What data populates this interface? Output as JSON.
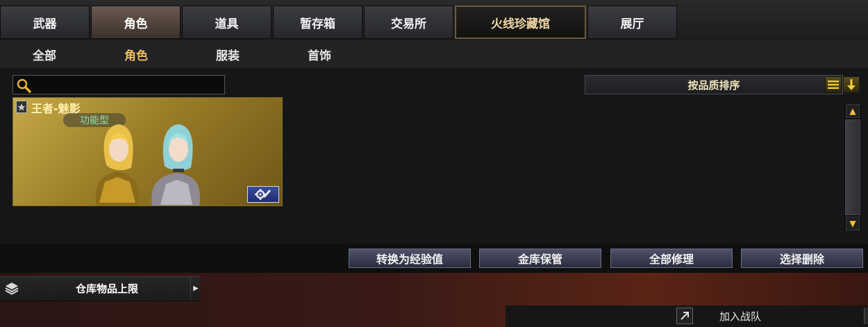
{
  "top_tabs": [
    {
      "label": "武器",
      "selected": false
    },
    {
      "label": "角色",
      "selected": true
    },
    {
      "label": "道具",
      "selected": false
    },
    {
      "label": "暂存箱",
      "selected": false
    },
    {
      "label": "交易所",
      "selected": false
    },
    {
      "label": "火线珍藏馆",
      "selected": false,
      "special": true
    },
    {
      "label": "展厅",
      "selected": false
    }
  ],
  "sub_tabs": [
    {
      "label": "全部",
      "selected": false
    },
    {
      "label": "角色",
      "selected": true
    },
    {
      "label": "服装",
      "selected": false
    },
    {
      "label": "首饰",
      "selected": false
    }
  ],
  "search": {
    "placeholder": "",
    "value": ""
  },
  "sort": {
    "label": "按品质排序",
    "icons": [
      "list-icon",
      "arrow-down-icon"
    ]
  },
  "items": [
    {
      "name": "王者-魅影",
      "type": "功能型",
      "rank_icon": "rank-badge-icon",
      "action_icon": "gear-wrench-icon",
      "card_color": "#b8962f"
    }
  ],
  "actions": [
    {
      "label": "转换为经验值"
    },
    {
      "label": "金库保管"
    },
    {
      "label": "全部修理"
    },
    {
      "label": "选择删除"
    }
  ],
  "storage_limit": {
    "label": "仓库物品上限",
    "icon": "layers-icon"
  },
  "squad": {
    "label": "加入战队",
    "icon": "external-link-icon"
  },
  "colors": {
    "accent_gold": "#ecbd5d",
    "special_tab_border": "#6c5a3a",
    "button_blue": "#3a4c9a"
  }
}
